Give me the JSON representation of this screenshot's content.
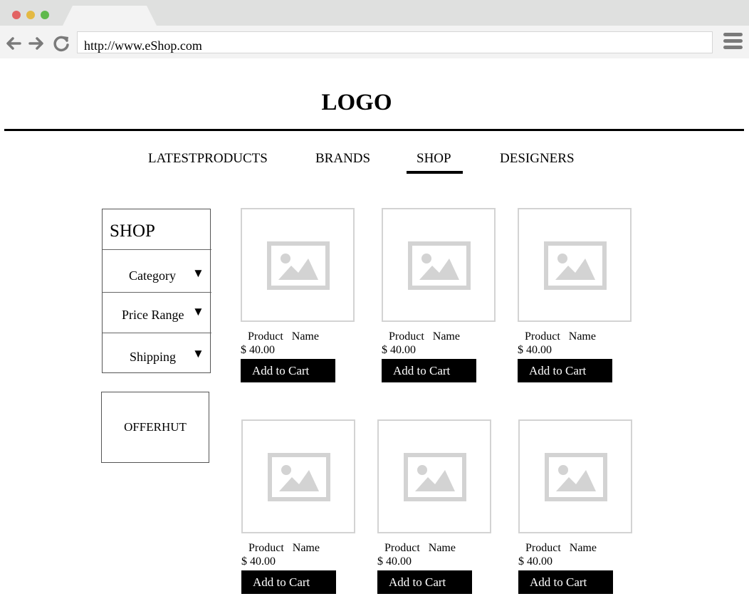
{
  "browser": {
    "url": "http://www.eShop.com",
    "traffic_colors": [
      "#e26363",
      "#e4b943",
      "#5fb94c"
    ]
  },
  "header": {
    "logo": "LOGO"
  },
  "nav": {
    "items": [
      {
        "label": "LATESTPRODUCTS"
      },
      {
        "label": "BRANDS"
      },
      {
        "label": "SHOP",
        "active": true
      },
      {
        "label": "DESIGNERS"
      }
    ]
  },
  "sidebar": {
    "title": "SHOP",
    "filters": [
      {
        "label": "Category"
      },
      {
        "label": "Price Range"
      },
      {
        "label": "Shipping"
      }
    ],
    "dropdown_icon": "triangle-down-icon",
    "offer": "OFFERHUT"
  },
  "products": [
    {
      "name": "Product   Name",
      "price": "$ 40.00",
      "cart_label": "Add to Cart"
    },
    {
      "name": "Product   Name",
      "price": "$ 40.00",
      "cart_label": "Add to Cart"
    },
    {
      "name": "Product   Name",
      "price": "$ 40.00",
      "cart_label": "Add to Cart"
    },
    {
      "name": "Product   Name",
      "price": "$ 40.00",
      "cart_label": "Add to Cart"
    },
    {
      "name": "Product   Name",
      "price": "$ 40.00",
      "cart_label": "Add to Cart"
    },
    {
      "name": "Product   Name",
      "price": "$ 40.00",
      "cart_label": "Add to Cart"
    }
  ],
  "icons": {
    "placeholder": "image-placeholder-icon",
    "back": "back-arrow-icon",
    "forward": "forward-arrow-icon",
    "reload": "reload-icon",
    "menu": "hamburger-menu-icon"
  },
  "colors": {
    "chrome": "#dfe0df",
    "toolbar": "#f3f3f3",
    "icon_gray": "#7a7a7a",
    "placeholder_gray": "#d3d3d3",
    "button": "#000000"
  }
}
